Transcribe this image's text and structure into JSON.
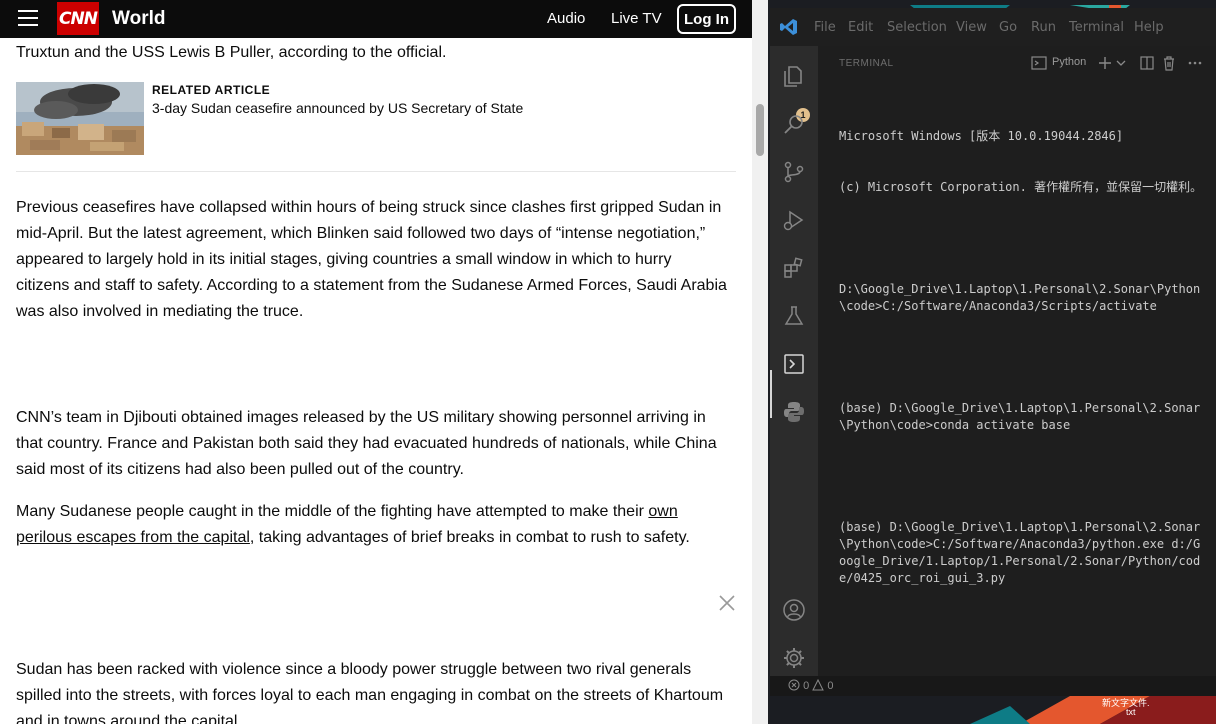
{
  "cnn": {
    "logo": "CNN",
    "section": "World",
    "nav": {
      "audio": "Audio",
      "live_tv": "Live TV",
      "login": "Log In"
    },
    "lead_line": "Truxtun and the USS Lewis B Puller, according to the official.",
    "related": {
      "label": "RELATED ARTICLE",
      "title": "3-day Sudan ceasefire announced by US Secretary of State"
    },
    "para1": "Previous ceasefires have collapsed within hours of being struck since clashes first gripped Sudan in mid-April. But the latest agreement, which Blinken said followed two days of “intense negotiation,” appeared to largely hold in its initial stages, giving countries a small window in which to hurry citizens and staff to safety. According to a statement from the Sudanese Armed Forces, Saudi Arabia was also involved in mediating the truce.",
    "para2": "CNN’s team in Djibouti obtained images released by the US military showing personnel arriving in that country. France and Pakistan both said they had evacuated hundreds of nationals, while China said most of its citizens had also been pulled out of the country.",
    "para3_before": "Many Sudanese people caught in the middle of the fighting have attempted to make their ",
    "para3_link": "own perilous escapes from the capital",
    "para3_after": ", taking advantages of brief breaks in combat to rush to safety.",
    "para4": "Sudan has been racked with violence since a bloody power struggle between two rival generals spilled into the streets, with forces loyal to each man engaging in combat on the streets of Khartoum and in towns around the capital."
  },
  "vscode": {
    "menu": [
      "File",
      "Edit",
      "Selection",
      "View",
      "Go",
      "Run",
      "Terminal",
      "Help"
    ],
    "source_control_badge": "1",
    "panel_title": "TERMINAL",
    "terminal_name": "Python",
    "terminal_lines": [
      "Microsoft Windows [版本 10.0.19044.2846]",
      "(c) Microsoft Corporation. 著作權所有，並保留一切權利。",
      "",
      "D:\\Google_Drive\\1.Laptop\\1.Personal\\2.Sonar\\Python\\code>C:/Software/Anaconda3/Scripts/activate",
      "",
      "(base) D:\\Google_Drive\\1.Laptop\\1.Personal\\2.Sonar\\Python\\code>conda activate base",
      "",
      "(base) D:\\Google_Drive\\1.Laptop\\1.Personal\\2.Sonar\\Python\\code>C:/Software/Anaconda3/python.exe d:/Google_Drive/1.Laptop/1.Personal/2.Sonar/Python/code/0425_orc_roi_gui_3.py"
    ],
    "status": {
      "errors": "0",
      "warnings": "0"
    }
  },
  "desktop": {
    "label1": "新文字文件.",
    "label2": "txt"
  },
  "colors": {
    "cnn_red": "#cc0000",
    "vscode_blue": "#3c8fd9",
    "badge": "#e2c08d"
  }
}
